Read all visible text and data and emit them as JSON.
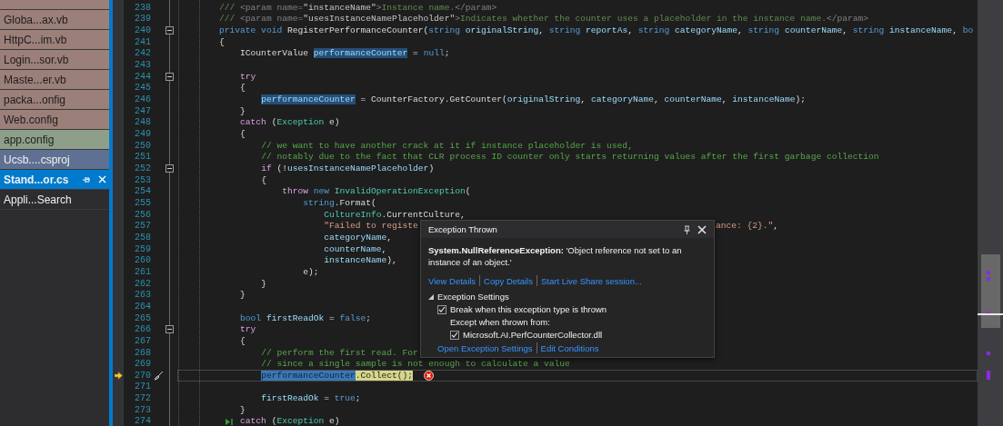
{
  "file_tabs": [
    {
      "color": "#9b7f79",
      "selected": false
    },
    {
      "label": "Globa...ax.vb",
      "color": "#9b7f79",
      "selected": false
    },
    {
      "label": "HttpC...im.vb",
      "color": "#9b7f79",
      "selected": false
    },
    {
      "label": "Login...sor.vb",
      "color": "#9b7f79",
      "selected": false
    },
    {
      "label": "Maste...er.vb",
      "color": "#9b7f79",
      "selected": false
    },
    {
      "label": "packa...onfig",
      "color": "#9b7f79",
      "selected": false
    },
    {
      "label": "Web.config",
      "color": "#9b7f79",
      "selected": false
    },
    {
      "label": "app.config",
      "color": "#8d9f88",
      "selected": false
    },
    {
      "label": "Ucsb....csproj",
      "color": "#5f7192",
      "selected": false
    },
    {
      "label": "Stand...or.cs",
      "color": "#007acc",
      "selected": true
    },
    {
      "label": "Appli...Search",
      "color": "#2d2d30",
      "selected": false
    }
  ],
  "editor": {
    "lines": [
      {
        "number": "238",
        "foldable": false,
        "current": false,
        "run_to_click": false,
        "tokens": [
          {
            "text": "        /// ",
            "kind": "doc"
          },
          {
            "text": "<param name=",
            "kind": "tag"
          },
          {
            "text": "\"instanceName\"",
            "kind": "docattr"
          },
          {
            "text": ">",
            "kind": "tag"
          },
          {
            "text": "Instance name.",
            "kind": "doc"
          },
          {
            "text": "</param>",
            "kind": "tag"
          }
        ]
      },
      {
        "number": "239",
        "foldable": false,
        "current": false,
        "run_to_click": false,
        "tokens": [
          {
            "text": "        /// ",
            "kind": "doc"
          },
          {
            "text": "<param name=",
            "kind": "tag"
          },
          {
            "text": "\"usesInstanceNamePlaceholder\"",
            "kind": "docattr"
          },
          {
            "text": ">",
            "kind": "tag"
          },
          {
            "text": "Indicates whether the counter uses a placeholder in the instance name.",
            "kind": "doc"
          },
          {
            "text": "</param>",
            "kind": "tag"
          }
        ]
      },
      {
        "number": "240",
        "foldable": true,
        "current": false,
        "run_to_click": false,
        "tokens": [
          {
            "text": "        private void",
            "kind": "kw"
          },
          {
            "text": " RegisterPerformanceCounter(",
            "kind": "plain"
          },
          {
            "text": "string",
            "kind": "kw"
          },
          {
            "text": " originalString",
            "kind": "var"
          },
          {
            "text": ", ",
            "kind": "plain"
          },
          {
            "text": "string",
            "kind": "kw"
          },
          {
            "text": " reportAs",
            "kind": "var"
          },
          {
            "text": ", ",
            "kind": "plain"
          },
          {
            "text": "string",
            "kind": "kw"
          },
          {
            "text": " categoryName",
            "kind": "var"
          },
          {
            "text": ", ",
            "kind": "plain"
          },
          {
            "text": "string",
            "kind": "kw"
          },
          {
            "text": " counterName",
            "kind": "var"
          },
          {
            "text": ", ",
            "kind": "plain"
          },
          {
            "text": "string",
            "kind": "kw"
          },
          {
            "text": " instanceName",
            "kind": "var"
          },
          {
            "text": ", ",
            "kind": "plain"
          },
          {
            "text": "bo",
            "kind": "kw"
          }
        ]
      },
      {
        "number": "241",
        "foldable": false,
        "current": false,
        "run_to_click": false,
        "tokens": [
          {
            "text": "        {",
            "kind": "plain"
          }
        ]
      },
      {
        "number": "242",
        "foldable": false,
        "current": false,
        "run_to_click": false,
        "tokens": [
          {
            "text": "            ICounterValue ",
            "kind": "plain"
          },
          {
            "text": "performanceCounter",
            "kind": "ref"
          },
          {
            "text": " = ",
            "kind": "plain"
          },
          {
            "text": "null",
            "kind": "kw"
          },
          {
            "text": ";",
            "kind": "plain"
          }
        ]
      },
      {
        "number": "243",
        "foldable": false,
        "current": false,
        "run_to_click": false
      },
      {
        "number": "244",
        "foldable": true,
        "current": false,
        "run_to_click": false,
        "tokens": [
          {
            "text": "            try",
            "kind": "ctl"
          }
        ]
      },
      {
        "number": "245",
        "foldable": false,
        "current": false,
        "run_to_click": false,
        "tokens": [
          {
            "text": "            {",
            "kind": "plain"
          }
        ]
      },
      {
        "number": "246",
        "foldable": false,
        "current": false,
        "run_to_click": false,
        "tokens": [
          {
            "text": "                performanceCounter",
            "kind": "ref"
          },
          {
            "text": " = ",
            "kind": "plain"
          },
          {
            "text": "CounterFactory",
            "kind": "plain"
          },
          {
            "text": ".GetCounter(",
            "kind": "plain"
          },
          {
            "text": "originalString",
            "kind": "var"
          },
          {
            "text": ", ",
            "kind": "plain"
          },
          {
            "text": "categoryName",
            "kind": "var"
          },
          {
            "text": ", ",
            "kind": "plain"
          },
          {
            "text": "counterName",
            "kind": "var"
          },
          {
            "text": ", ",
            "kind": "plain"
          },
          {
            "text": "instanceName",
            "kind": "var"
          },
          {
            "text": ");",
            "kind": "plain"
          }
        ]
      },
      {
        "number": "247",
        "foldable": false,
        "current": false,
        "run_to_click": false,
        "tokens": [
          {
            "text": "            }",
            "kind": "plain"
          }
        ]
      },
      {
        "number": "248",
        "foldable": false,
        "current": false,
        "run_to_click": false,
        "tokens": [
          {
            "text": "            catch",
            "kind": "ctl"
          },
          {
            "text": " (",
            "kind": "plain"
          },
          {
            "text": "Exception",
            "kind": "type"
          },
          {
            "text": " e)",
            "kind": "plain"
          }
        ]
      },
      {
        "number": "249",
        "foldable": false,
        "current": false,
        "run_to_click": false,
        "tokens": [
          {
            "text": "            {",
            "kind": "plain"
          }
        ]
      },
      {
        "number": "250",
        "foldable": false,
        "current": false,
        "run_to_click": false,
        "tokens": [
          {
            "text": "                // we want to have another crack at it if instance placeholder is used,",
            "kind": "cmt"
          }
        ]
      },
      {
        "number": "251",
        "foldable": false,
        "current": false,
        "run_to_click": false,
        "tokens": [
          {
            "text": "                // notably due to the fact that CLR process ID counter only starts returning values after the first garbage collection",
            "kind": "cmt"
          }
        ]
      },
      {
        "number": "252",
        "foldable": true,
        "current": false,
        "run_to_click": false,
        "tokens": [
          {
            "text": "                if",
            "kind": "ctl"
          },
          {
            "text": " (!",
            "kind": "plain"
          },
          {
            "text": "usesInstanceNamePlaceholder",
            "kind": "var"
          },
          {
            "text": ")",
            "kind": "plain"
          }
        ]
      },
      {
        "number": "253",
        "foldable": false,
        "current": false,
        "run_to_click": false,
        "tokens": [
          {
            "text": "                {",
            "kind": "plain"
          }
        ]
      },
      {
        "number": "254",
        "foldable": false,
        "current": false,
        "run_to_click": false,
        "tokens": [
          {
            "text": "                    throw",
            "kind": "ctl"
          },
          {
            "text": " new",
            "kind": "kw"
          },
          {
            "text": " InvalidOperationException",
            "kind": "type"
          },
          {
            "text": "(",
            "kind": "plain"
          }
        ]
      },
      {
        "number": "255",
        "foldable": false,
        "current": false,
        "run_to_click": false,
        "tokens": [
          {
            "text": "                        string",
            "kind": "kw"
          },
          {
            "text": ".Format(",
            "kind": "plain"
          }
        ]
      },
      {
        "number": "256",
        "foldable": false,
        "current": false,
        "run_to_click": false,
        "tokens": [
          {
            "text": "                            CultureInfo",
            "kind": "type"
          },
          {
            "text": ".CurrentCulture,",
            "kind": "plain"
          }
        ]
      },
      {
        "number": "257",
        "foldable": false,
        "current": false,
        "run_to_click": false,
        "tokens": [
          {
            "text": "                            \"Failed to registe",
            "kind": "str"
          }
        ],
        "tail": [
          {
            "text": "ance: {2}.\"",
            "kind": "str"
          },
          {
            "text": ",",
            "kind": "plain"
          }
        ]
      },
      {
        "number": "258",
        "foldable": false,
        "current": false,
        "run_to_click": false,
        "tokens": [
          {
            "text": "                            categoryName",
            "kind": "var"
          },
          {
            "text": ",",
            "kind": "plain"
          }
        ]
      },
      {
        "number": "259",
        "foldable": false,
        "current": false,
        "run_to_click": false,
        "tokens": [
          {
            "text": "                            counterName",
            "kind": "var"
          },
          {
            "text": ",",
            "kind": "plain"
          }
        ]
      },
      {
        "number": "260",
        "foldable": false,
        "current": false,
        "run_to_click": false,
        "tokens": [
          {
            "text": "                            instanceName",
            "kind": "var"
          },
          {
            "text": "),",
            "kind": "plain"
          }
        ]
      },
      {
        "number": "261",
        "foldable": false,
        "current": false,
        "run_to_click": false,
        "tokens": [
          {
            "text": "                        e);",
            "kind": "plain"
          }
        ]
      },
      {
        "number": "262",
        "foldable": false,
        "current": false,
        "run_to_click": false,
        "tokens": [
          {
            "text": "                }",
            "kind": "plain"
          }
        ]
      },
      {
        "number": "263",
        "foldable": false,
        "current": false,
        "run_to_click": false,
        "tokens": [
          {
            "text": "            }",
            "kind": "plain"
          }
        ]
      },
      {
        "number": "264",
        "foldable": false,
        "current": false,
        "run_to_click": false
      },
      {
        "number": "265",
        "foldable": false,
        "current": false,
        "run_to_click": false,
        "tokens": [
          {
            "text": "            bool",
            "kind": "kw"
          },
          {
            "text": " firstReadOk",
            "kind": "var"
          },
          {
            "text": " = ",
            "kind": "plain"
          },
          {
            "text": "false",
            "kind": "kw"
          },
          {
            "text": ";",
            "kind": "plain"
          }
        ]
      },
      {
        "number": "266",
        "foldable": true,
        "current": false,
        "run_to_click": false,
        "tokens": [
          {
            "text": "            try",
            "kind": "ctl"
          }
        ]
      },
      {
        "number": "267",
        "foldable": false,
        "current": false,
        "run_to_click": false,
        "tokens": [
          {
            "text": "            {",
            "kind": "plain"
          }
        ]
      },
      {
        "number": "268",
        "foldable": false,
        "current": false,
        "run_to_click": false,
        "tokens": [
          {
            "text": "                // perform the first read. For",
            "kind": "cmt"
          }
        ]
      },
      {
        "number": "269",
        "foldable": false,
        "current": false,
        "run_to_click": false,
        "tokens": [
          {
            "text": "                // since a single sample is not enough to calculate a value",
            "kind": "cmt"
          }
        ]
      },
      {
        "number": "270",
        "foldable": false,
        "current": true,
        "run_to_click": false,
        "tokens": [
          {
            "text": "                performanceCounter",
            "kind": "curref"
          },
          {
            "text": ".Collect();",
            "kind": "cur"
          }
        ]
      },
      {
        "number": "271",
        "foldable": false,
        "current": false,
        "run_to_click": false
      },
      {
        "number": "272",
        "foldable": false,
        "current": false,
        "run_to_click": false,
        "tokens": [
          {
            "text": "                firstReadOk",
            "kind": "var"
          },
          {
            "text": " = ",
            "kind": "plain"
          },
          {
            "text": "true",
            "kind": "kw"
          },
          {
            "text": ";",
            "kind": "plain"
          }
        ]
      },
      {
        "number": "273",
        "foldable": false,
        "current": false,
        "run_to_click": false,
        "tokens": [
          {
            "text": "            }",
            "kind": "plain"
          }
        ]
      },
      {
        "number": "274",
        "foldable": false,
        "current": false,
        "run_to_click": true,
        "tokens": [
          {
            "text": "            catch",
            "kind": "ctl"
          },
          {
            "text": " (",
            "kind": "plain"
          },
          {
            "text": "Exception",
            "kind": "type"
          },
          {
            "text": " e)",
            "kind": "plain"
          }
        ]
      }
    ]
  },
  "exception_popup": {
    "title": "Exception Thrown",
    "message": "**System.NullReferenceException:** 'Object reference not set to an instance of an object.'",
    "links": [
      "View Details",
      "Copy Details",
      "Start Live Share session..."
    ],
    "settings": {
      "title": "Exception Settings",
      "expanded": true,
      "break_option": {
        "label": "Break when this exception type is thrown",
        "checked": true
      },
      "except_label": "Except when thrown from:",
      "modules": [
        {
          "label": "Microsoft.AI.PerfCounterCollector.dll",
          "checked": true
        }
      ],
      "links": [
        "Open Exception Settings",
        "Edit Conditions"
      ]
    }
  }
}
